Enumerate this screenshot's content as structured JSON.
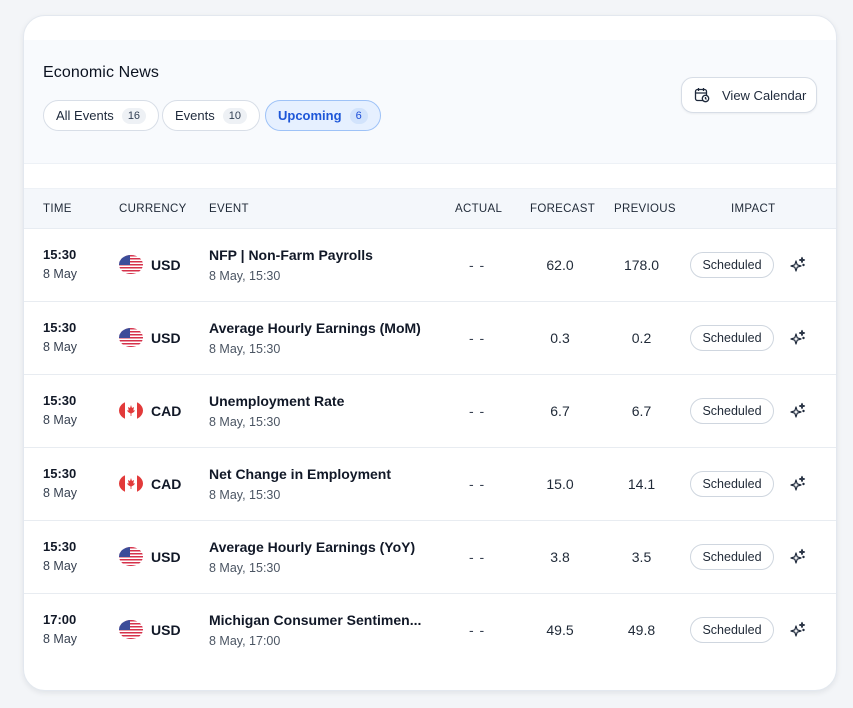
{
  "header": {
    "title": "Economic News",
    "view_calendar_label": "View Calendar"
  },
  "filters": [
    {
      "label": "All Events",
      "count": "16",
      "active": false
    },
    {
      "label": "Events",
      "count": "10",
      "active": false
    },
    {
      "label": "Upcoming",
      "count": "6",
      "active": true
    }
  ],
  "table": {
    "columns": {
      "time": "TIME",
      "currency": "CURRENCY",
      "event": "EVENT",
      "actual": "ACTUAL",
      "forecast": "FORECAST",
      "previous": "PREVIOUS",
      "impact": "IMPACT"
    },
    "rows": [
      {
        "time": "15:30",
        "date": "8 May",
        "currency": "USD",
        "flag": "us-flag-icon",
        "event": "NFP | Non-Farm Payrolls",
        "event_time": "8 May, 15:30",
        "actual": "- -",
        "forecast": "62.0",
        "previous": "178.0",
        "impact": "Scheduled"
      },
      {
        "time": "15:30",
        "date": "8 May",
        "currency": "USD",
        "flag": "us-flag-icon",
        "event": "Average Hourly Earnings (MoM)",
        "event_time": "8 May, 15:30",
        "actual": "- -",
        "forecast": "0.3",
        "previous": "0.2",
        "impact": "Scheduled"
      },
      {
        "time": "15:30",
        "date": "8 May",
        "currency": "CAD",
        "flag": "canada-flag-icon",
        "event": "Unemployment Rate",
        "event_time": "8 May, 15:30",
        "actual": "- -",
        "forecast": "6.7",
        "previous": "6.7",
        "impact": "Scheduled"
      },
      {
        "time": "15:30",
        "date": "8 May",
        "currency": "CAD",
        "flag": "canada-flag-icon",
        "event": "Net Change in Employment",
        "event_time": "8 May, 15:30",
        "actual": "- -",
        "forecast": "15.0",
        "previous": "14.1",
        "impact": "Scheduled"
      },
      {
        "time": "15:30",
        "date": "8 May",
        "currency": "USD",
        "flag": "us-flag-icon",
        "event": "Average Hourly Earnings (YoY)",
        "event_time": "8 May, 15:30",
        "actual": "- -",
        "forecast": "3.8",
        "previous": "3.5",
        "impact": "Scheduled"
      },
      {
        "time": "17:00",
        "date": "8 May",
        "currency": "USD",
        "flag": "us-flag-icon",
        "event": "Michigan Consumer Sentimen...",
        "event_time": "8 May, 17:00",
        "actual": "- -",
        "forecast": "49.5",
        "previous": "49.8",
        "impact": "Scheduled"
      }
    ]
  },
  "colors": {
    "accent": "#1d56d8",
    "active_pill_bg": "#e6f0ff"
  }
}
